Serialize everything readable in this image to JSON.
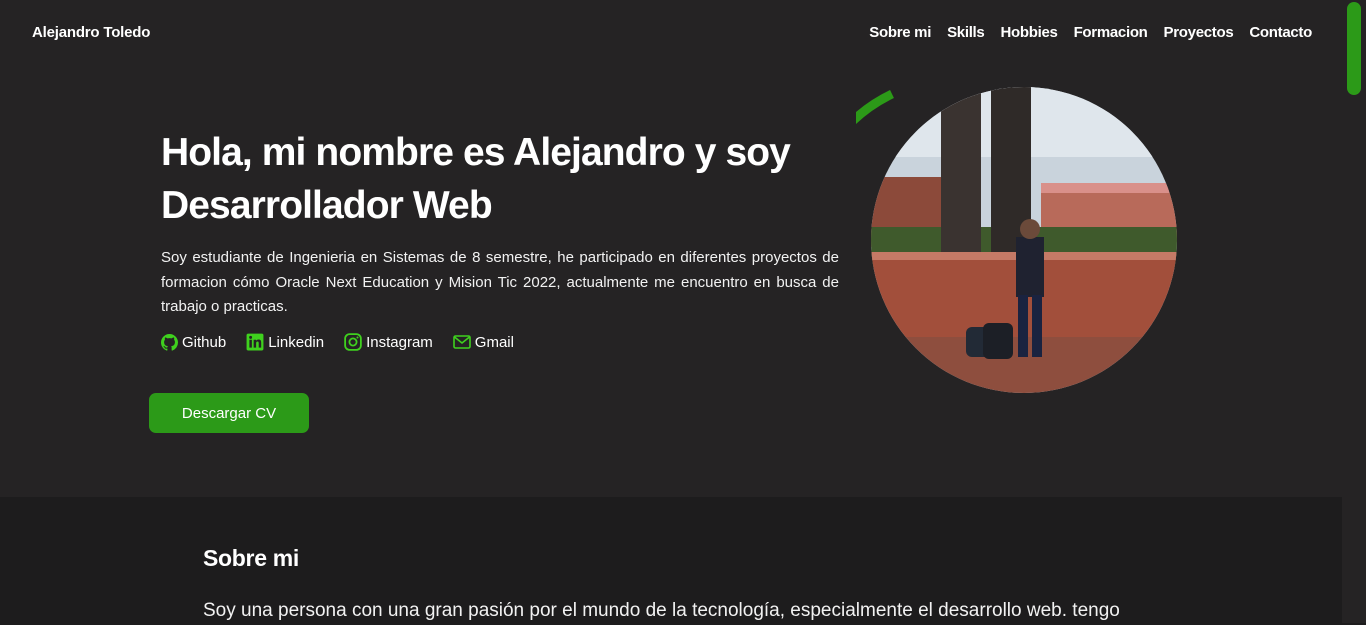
{
  "header": {
    "brand": "Alejandro Toledo",
    "nav": [
      "Sobre mi",
      "Skills",
      "Hobbies",
      "Formacion",
      "Proyectos",
      "Contacto"
    ]
  },
  "hero": {
    "headline": "Hola, mi nombre es Alejandro y soy Desarrollador Web",
    "intro": "Soy estudiante de Ingenieria en Sistemas de 8 semestre, he participado en diferentes proyectos de formacion cómo Oracle Next Education y Mision Tic 2022, actualmente me encuentro en busca de trabajo o practicas.",
    "social": [
      {
        "label": "Github",
        "icon": "github-icon"
      },
      {
        "label": "Linkedin",
        "icon": "linkedin-icon"
      },
      {
        "label": "Instagram",
        "icon": "instagram-icon"
      },
      {
        "label": "Gmail",
        "icon": "mail-icon"
      }
    ],
    "cv_button": "Descargar CV"
  },
  "about": {
    "title": "Sobre mi",
    "text": "Soy una persona con una gran pasión por el mundo de la tecnología, especialmente el desarrollo web. tengo"
  },
  "colors": {
    "accent": "#2c9a18",
    "icon_green": "#3fd11e",
    "hero_bg": "#252324",
    "page_bg": "#1d1c1d"
  }
}
